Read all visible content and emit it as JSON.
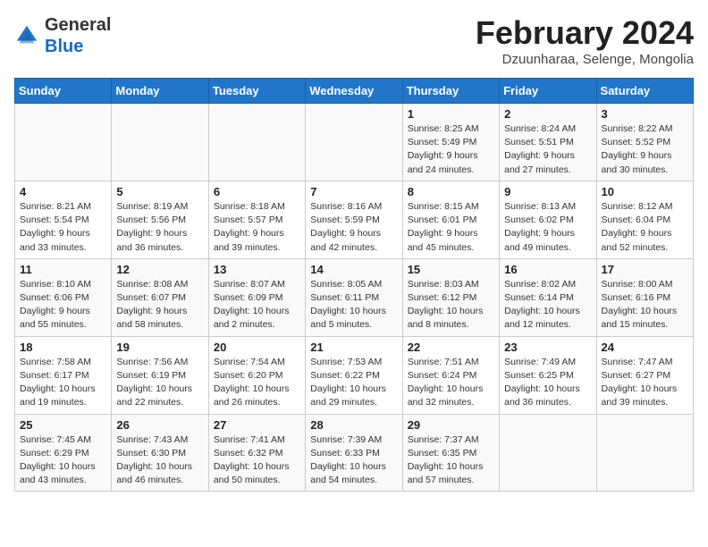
{
  "logo": {
    "general": "General",
    "blue": "Blue"
  },
  "title": "February 2024",
  "subtitle": "Dzuunharaa, Selenge, Mongolia",
  "weekdays": [
    "Sunday",
    "Monday",
    "Tuesday",
    "Wednesday",
    "Thursday",
    "Friday",
    "Saturday"
  ],
  "weeks": [
    [
      {
        "day": "",
        "info": ""
      },
      {
        "day": "",
        "info": ""
      },
      {
        "day": "",
        "info": ""
      },
      {
        "day": "",
        "info": ""
      },
      {
        "day": "1",
        "info": "Sunrise: 8:25 AM\nSunset: 5:49 PM\nDaylight: 9 hours and 24 minutes."
      },
      {
        "day": "2",
        "info": "Sunrise: 8:24 AM\nSunset: 5:51 PM\nDaylight: 9 hours and 27 minutes."
      },
      {
        "day": "3",
        "info": "Sunrise: 8:22 AM\nSunset: 5:52 PM\nDaylight: 9 hours and 30 minutes."
      }
    ],
    [
      {
        "day": "4",
        "info": "Sunrise: 8:21 AM\nSunset: 5:54 PM\nDaylight: 9 hours and 33 minutes."
      },
      {
        "day": "5",
        "info": "Sunrise: 8:19 AM\nSunset: 5:56 PM\nDaylight: 9 hours and 36 minutes."
      },
      {
        "day": "6",
        "info": "Sunrise: 8:18 AM\nSunset: 5:57 PM\nDaylight: 9 hours and 39 minutes."
      },
      {
        "day": "7",
        "info": "Sunrise: 8:16 AM\nSunset: 5:59 PM\nDaylight: 9 hours and 42 minutes."
      },
      {
        "day": "8",
        "info": "Sunrise: 8:15 AM\nSunset: 6:01 PM\nDaylight: 9 hours and 45 minutes."
      },
      {
        "day": "9",
        "info": "Sunrise: 8:13 AM\nSunset: 6:02 PM\nDaylight: 9 hours and 49 minutes."
      },
      {
        "day": "10",
        "info": "Sunrise: 8:12 AM\nSunset: 6:04 PM\nDaylight: 9 hours and 52 minutes."
      }
    ],
    [
      {
        "day": "11",
        "info": "Sunrise: 8:10 AM\nSunset: 6:06 PM\nDaylight: 9 hours and 55 minutes."
      },
      {
        "day": "12",
        "info": "Sunrise: 8:08 AM\nSunset: 6:07 PM\nDaylight: 9 hours and 58 minutes."
      },
      {
        "day": "13",
        "info": "Sunrise: 8:07 AM\nSunset: 6:09 PM\nDaylight: 10 hours and 2 minutes."
      },
      {
        "day": "14",
        "info": "Sunrise: 8:05 AM\nSunset: 6:11 PM\nDaylight: 10 hours and 5 minutes."
      },
      {
        "day": "15",
        "info": "Sunrise: 8:03 AM\nSunset: 6:12 PM\nDaylight: 10 hours and 8 minutes."
      },
      {
        "day": "16",
        "info": "Sunrise: 8:02 AM\nSunset: 6:14 PM\nDaylight: 10 hours and 12 minutes."
      },
      {
        "day": "17",
        "info": "Sunrise: 8:00 AM\nSunset: 6:16 PM\nDaylight: 10 hours and 15 minutes."
      }
    ],
    [
      {
        "day": "18",
        "info": "Sunrise: 7:58 AM\nSunset: 6:17 PM\nDaylight: 10 hours and 19 minutes."
      },
      {
        "day": "19",
        "info": "Sunrise: 7:56 AM\nSunset: 6:19 PM\nDaylight: 10 hours and 22 minutes."
      },
      {
        "day": "20",
        "info": "Sunrise: 7:54 AM\nSunset: 6:20 PM\nDaylight: 10 hours and 26 minutes."
      },
      {
        "day": "21",
        "info": "Sunrise: 7:53 AM\nSunset: 6:22 PM\nDaylight: 10 hours and 29 minutes."
      },
      {
        "day": "22",
        "info": "Sunrise: 7:51 AM\nSunset: 6:24 PM\nDaylight: 10 hours and 32 minutes."
      },
      {
        "day": "23",
        "info": "Sunrise: 7:49 AM\nSunset: 6:25 PM\nDaylight: 10 hours and 36 minutes."
      },
      {
        "day": "24",
        "info": "Sunrise: 7:47 AM\nSunset: 6:27 PM\nDaylight: 10 hours and 39 minutes."
      }
    ],
    [
      {
        "day": "25",
        "info": "Sunrise: 7:45 AM\nSunset: 6:29 PM\nDaylight: 10 hours and 43 minutes."
      },
      {
        "day": "26",
        "info": "Sunrise: 7:43 AM\nSunset: 6:30 PM\nDaylight: 10 hours and 46 minutes."
      },
      {
        "day": "27",
        "info": "Sunrise: 7:41 AM\nSunset: 6:32 PM\nDaylight: 10 hours and 50 minutes."
      },
      {
        "day": "28",
        "info": "Sunrise: 7:39 AM\nSunset: 6:33 PM\nDaylight: 10 hours and 54 minutes."
      },
      {
        "day": "29",
        "info": "Sunrise: 7:37 AM\nSunset: 6:35 PM\nDaylight: 10 hours and 57 minutes."
      },
      {
        "day": "",
        "info": ""
      },
      {
        "day": "",
        "info": ""
      }
    ]
  ]
}
